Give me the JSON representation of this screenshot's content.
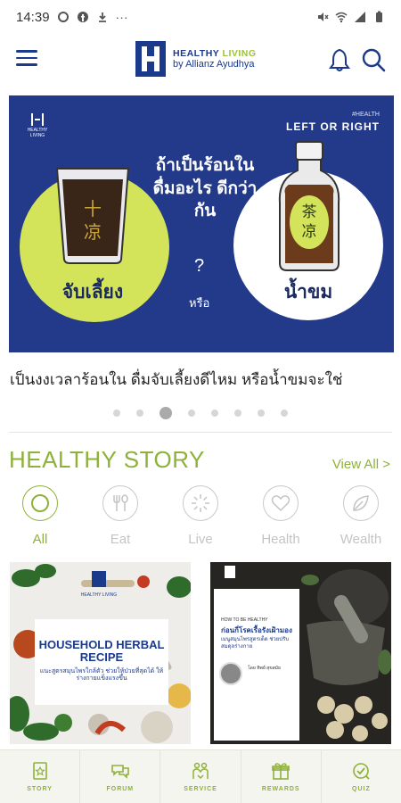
{
  "status_bar": {
    "time": "14:39"
  },
  "header": {
    "logo_line1_a": "HEALTHY",
    "logo_line1_b": "LIVING",
    "logo_line2": "by Allianz Ayudhya"
  },
  "hero": {
    "brand": "HEALTHY LIVING",
    "tag": "#HEALTH",
    "tagline": "LEFT OR RIGHT",
    "question": "ถ้าเป็นร้อนใน ดื่มอะไร ดีกว่ากัน",
    "qmark": "?",
    "or": "หรือ",
    "glass_text_1": "十",
    "glass_text_2": "凉",
    "bottle_text_1": "茶",
    "bottle_text_2": "凉",
    "left_label": "จับเลี้ยง",
    "right_label": "น้ำขม"
  },
  "caption": "เป็นงงเวลาร้อนใน ดื่มจับเลี้ยงดีไหม หรือน้ำขมจะใช่",
  "carousel": {
    "count": 8,
    "active_index": 2
  },
  "story": {
    "title": "HEALTHY STORY",
    "view_all": "View All >"
  },
  "categories": [
    {
      "label": "All",
      "icon": "all-icon",
      "active": true
    },
    {
      "label": "Eat",
      "icon": "fork-spoon-icon",
      "active": false
    },
    {
      "label": "Live",
      "icon": "sun-rays-icon",
      "active": false
    },
    {
      "label": "Health",
      "icon": "heart-icon",
      "active": false
    },
    {
      "label": "Wealth",
      "icon": "leaf-icon",
      "active": false
    }
  ],
  "cards": [
    {
      "top": "HEALTHY LIVING",
      "title": "HOUSEHOLD HERBAL RECIPE",
      "subtitle": "แนะสูตรสมุนไพรใกล้ตัว ช่วยให้ป่วยที่สุดได้ ให้ร่างกายแข็งแรงขึ้น"
    },
    {
      "top": "HOW TO BE HEALTHY",
      "title": "ก่อนกี่โรคเรื้อรังเฝ้ามอง",
      "subtitle": "เมนูสมุนไพรสูตรเด็ด ช่วยปรับสมดุลร่างกาย",
      "author": "โดย ทิพย์ สุขสมัย"
    }
  ],
  "bottom_nav": [
    {
      "label": "STORY",
      "icon": "story-icon"
    },
    {
      "label": "FORUM",
      "icon": "forum-icon"
    },
    {
      "label": "SERVICE",
      "icon": "service-icon"
    },
    {
      "label": "REWARDS",
      "icon": "rewards-icon"
    },
    {
      "label": "QUIZ",
      "icon": "quiz-icon"
    }
  ],
  "colors": {
    "brand_blue": "#1b3a8c",
    "accent_green": "#8eb13a",
    "hero_bg": "#233a8b",
    "lime_circle": "#d4e45a"
  }
}
